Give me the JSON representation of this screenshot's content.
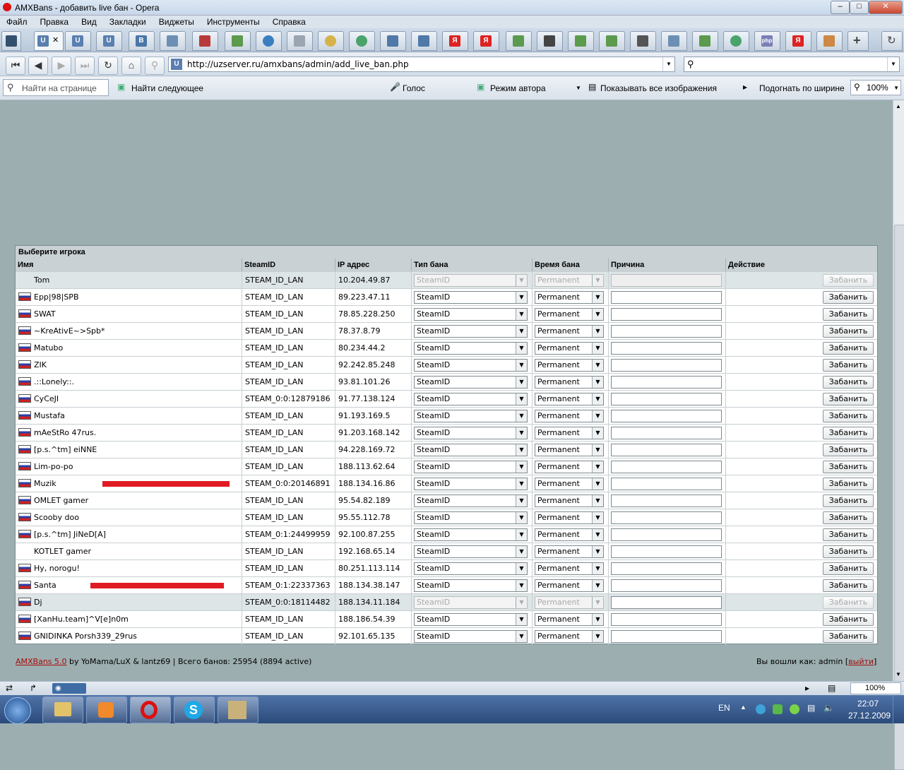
{
  "window": {
    "title": "AMXBans - добавить live бан - Opera"
  },
  "menu": [
    "Файл",
    "Правка",
    "Вид",
    "Закладки",
    "Виджеты",
    "Инструменты",
    "Справка"
  ],
  "address": {
    "url": "http://uzserver.ru/amxbans/admin/add_live_ban.php",
    "search_value": ""
  },
  "findbar": {
    "find_placeholder": "Найти на странице",
    "find_next": "Найти следующее",
    "voice": "Голос",
    "author_mode": "Режим автора",
    "show_images": "Показывать все изображения",
    "fit_width": "Подогнать по ширине",
    "zoom": "100%"
  },
  "panel": {
    "title": "Выберите игрока",
    "columns": [
      "Имя",
      "SteamID",
      "IP адрес",
      "Тип бана",
      "Время бана",
      "Причина",
      "Действие"
    ]
  },
  "players": [
    {
      "name": "Tom",
      "steamid": "STEAM_ID_LAN",
      "ip": "10.204.49.87",
      "ban_type": "SteamID",
      "ban_time": "Permanent",
      "flag": false,
      "disabled": true,
      "redacted": false
    },
    {
      "name": "Epp|98|SPB",
      "steamid": "STEAM_ID_LAN",
      "ip": "89.223.47.11",
      "ban_type": "SteamID",
      "ban_time": "Permanent",
      "flag": true,
      "disabled": false,
      "redacted": false
    },
    {
      "name": "SWAT",
      "steamid": "STEAM_ID_LAN",
      "ip": "78.85.228.250",
      "ban_type": "SteamID",
      "ban_time": "Permanent",
      "flag": true,
      "disabled": false,
      "redacted": false
    },
    {
      "name": "~KreAtivE~>Spb*",
      "steamid": "STEAM_ID_LAN",
      "ip": "78.37.8.79",
      "ban_type": "SteamID",
      "ban_time": "Permanent",
      "flag": true,
      "disabled": false,
      "redacted": false
    },
    {
      "name": "Matubo",
      "steamid": "STEAM_ID_LAN",
      "ip": "80.234.44.2",
      "ban_type": "SteamID",
      "ban_time": "Permanent",
      "flag": true,
      "disabled": false,
      "redacted": false
    },
    {
      "name": "ZIK",
      "steamid": "STEAM_ID_LAN",
      "ip": "92.242.85.248",
      "ban_type": "SteamID",
      "ban_time": "Permanent",
      "flag": true,
      "disabled": false,
      "redacted": false
    },
    {
      "name": ".::Lonely::.",
      "steamid": "STEAM_ID_LAN",
      "ip": "93.81.101.26",
      "ban_type": "SteamID",
      "ban_time": "Permanent",
      "flag": true,
      "disabled": false,
      "redacted": false
    },
    {
      "name": "CyCeJI",
      "steamid": "STEAM_0:0:12879186",
      "ip": "91.77.138.124",
      "ban_type": "SteamID",
      "ban_time": "Permanent",
      "flag": true,
      "disabled": false,
      "redacted": false
    },
    {
      "name": "Mustafa",
      "steamid": "STEAM_ID_LAN",
      "ip": "91.193.169.5",
      "ban_type": "SteamID",
      "ban_time": "Permanent",
      "flag": true,
      "disabled": false,
      "redacted": false
    },
    {
      "name": "mAeStRo 47rus.",
      "steamid": "STEAM_ID_LAN",
      "ip": "91.203.168.142",
      "ban_type": "SteamID",
      "ban_time": "Permanent",
      "flag": true,
      "disabled": false,
      "redacted": false
    },
    {
      "name": "[p.s.^tm] eiNNE",
      "steamid": "STEAM_ID_LAN",
      "ip": "94.228.169.72",
      "ban_type": "SteamID",
      "ban_time": "Permanent",
      "flag": true,
      "disabled": false,
      "redacted": false
    },
    {
      "name": "Lim-po-po",
      "steamid": "STEAM_ID_LAN",
      "ip": "188.113.62.64",
      "ban_type": "SteamID",
      "ban_time": "Permanent",
      "flag": true,
      "disabled": false,
      "redacted": false
    },
    {
      "name": "Muzik",
      "steamid": "STEAM_0:0:20146891",
      "ip": "188.134.16.86",
      "ban_type": "SteamID",
      "ban_time": "Permanent",
      "flag": true,
      "disabled": false,
      "redacted": true
    },
    {
      "name": "OMLET gamer",
      "steamid": "STEAM_ID_LAN",
      "ip": "95.54.82.189",
      "ban_type": "SteamID",
      "ban_time": "Permanent",
      "flag": true,
      "disabled": false,
      "redacted": false
    },
    {
      "name": "Scooby doo",
      "steamid": "STEAM_ID_LAN",
      "ip": "95.55.112.78",
      "ban_type": "SteamID",
      "ban_time": "Permanent",
      "flag": true,
      "disabled": false,
      "redacted": false
    },
    {
      "name": "[p.s.^tm] JiNeD[A]",
      "steamid": "STEAM_0:1:24499959",
      "ip": "92.100.87.255",
      "ban_type": "SteamID",
      "ban_time": "Permanent",
      "flag": true,
      "disabled": false,
      "redacted": false
    },
    {
      "name": "KOTLET gamer",
      "steamid": "STEAM_ID_LAN",
      "ip": "192.168.65.14",
      "ban_type": "SteamID",
      "ban_time": "Permanent",
      "flag": false,
      "disabled": false,
      "redacted": false
    },
    {
      "name": "Hy, norogu!",
      "steamid": "STEAM_ID_LAN",
      "ip": "80.251.113.114",
      "ban_type": "SteamID",
      "ban_time": "Permanent",
      "flag": true,
      "disabled": false,
      "redacted": false
    },
    {
      "name": "Santa",
      "steamid": "STEAM_0:1:22337363",
      "ip": "188.134.38.147",
      "ban_type": "SteamID",
      "ban_time": "Permanent",
      "flag": true,
      "disabled": false,
      "redacted": true
    },
    {
      "name": "Dj",
      "steamid": "STEAM_0:0:18114482",
      "ip": "188.134.11.184",
      "ban_type": "SteamID",
      "ban_time": "Permanent",
      "flag": true,
      "disabled": true,
      "redacted": false
    },
    {
      "name": "[XanHu.team]^V[e]n0m",
      "steamid": "STEAM_ID_LAN",
      "ip": "188.186.54.39",
      "ban_type": "SteamID",
      "ban_time": "Permanent",
      "flag": true,
      "disabled": false,
      "redacted": false
    },
    {
      "name": "GNIDINKA Porsh339_29rus",
      "steamid": "STEAM_ID_LAN",
      "ip": "92.101.65.135",
      "ban_type": "SteamID",
      "ban_time": "Permanent",
      "flag": true,
      "disabled": false,
      "redacted": false
    }
  ],
  "ban_button_label": "Забанить",
  "footer": {
    "version_link": "AMXBans 5.0",
    "credits": " by YoMama/LuX & lantz69 | Всего банов: 25954 (8894 active)",
    "logged_in": "Вы вошли как: admin [",
    "logout": "выйти",
    "logged_in_end": "]"
  },
  "statusbar": {
    "zoom": "100%"
  },
  "taskbar": {
    "lang": "EN",
    "time": "22:07",
    "date": "27.12.2009"
  }
}
